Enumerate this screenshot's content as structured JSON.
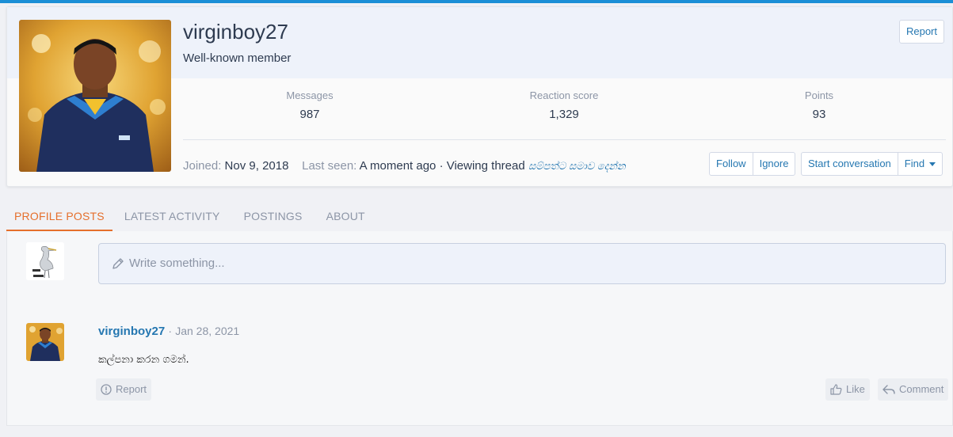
{
  "member": {
    "username": "virginboy27",
    "title": "Well-known member",
    "report_label": "Report",
    "stats": [
      {
        "label": "Messages",
        "value": "987"
      },
      {
        "label": "Reaction score",
        "value": "1,329"
      },
      {
        "label": "Points",
        "value": "93"
      }
    ],
    "joined_label": "Joined:",
    "joined_value": "Nov 9, 2018",
    "last_seen_label": "Last seen:",
    "last_seen_value": "A moment ago · Viewing thread",
    "last_seen_thread": "සම්පත්ට සමාව දෙන්න",
    "buttons": {
      "follow": "Follow",
      "ignore": "Ignore",
      "start_conversation": "Start conversation",
      "find": "Find"
    }
  },
  "tabs": [
    {
      "label": "PROFILE POSTS",
      "active": true
    },
    {
      "label": "LATEST ACTIVITY",
      "active": false
    },
    {
      "label": "POSTINGS",
      "active": false
    },
    {
      "label": "ABOUT",
      "active": false
    }
  ],
  "composer": {
    "placeholder": "Write something..."
  },
  "post": {
    "author": "virginboy27",
    "separator": "·",
    "date": "Jan 28, 2021",
    "body": "කල්පනා කරන ගමන්.",
    "actions": {
      "report": "Report",
      "like": "Like",
      "comment": "Comment"
    }
  },
  "colors": {
    "accent": "#1b8fd6",
    "link": "#2577b1",
    "active_tab": "#e56f2c",
    "muted": "#8c95a6"
  },
  "icons": {
    "composer": "pencil-icon",
    "report": "alert-circle-icon",
    "like": "thumbs-up-icon",
    "comment": "reply-icon",
    "find": "caret-down-icon"
  }
}
